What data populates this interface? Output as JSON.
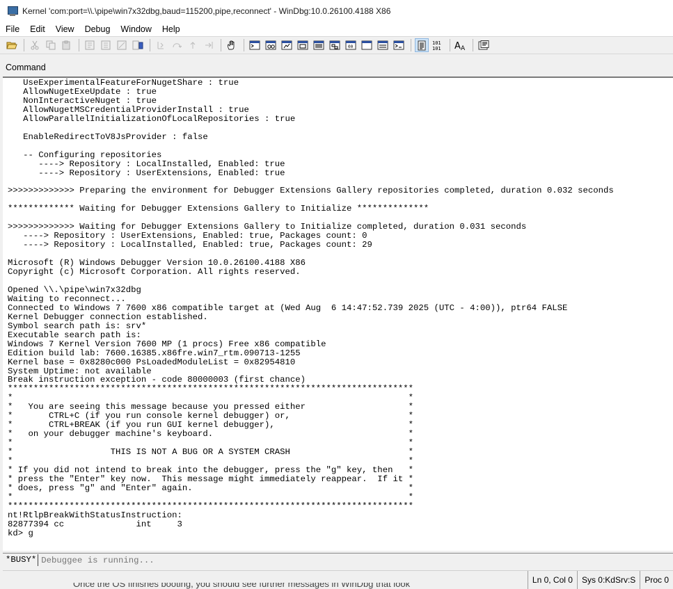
{
  "window": {
    "title": "Kernel 'com:port=\\\\.\\pipe\\win7x32dbg,baud=115200,pipe,reconnect' - WinDbg:10.0.26100.4188 X86"
  },
  "menu": {
    "items": [
      "File",
      "Edit",
      "View",
      "Debug",
      "Window",
      "Help"
    ]
  },
  "toolbar": {
    "buttons": [
      "open-icon",
      "cut-icon",
      "copy-icon",
      "paste-icon",
      "go-icon",
      "restart-icon",
      "stop-icon",
      "break-icon",
      "step-into-icon",
      "step-over-icon",
      "step-out-icon",
      "run-to-cursor-icon",
      "hand-icon",
      "command-icon",
      "watch-icon",
      "locals-icon",
      "registers-icon",
      "memory-icon",
      "call-stack-icon",
      "disassembly-icon",
      "scratch-pad-icon",
      "processes-icon",
      "source-mode-icon",
      "hex-icon",
      "font-icon",
      "options-icon"
    ]
  },
  "command_pane": {
    "title": "Command",
    "output_lines": [
      "   UseExperimentalFeatureForNugetShare : true",
      "   AllowNugetExeUpdate : true",
      "   NonInteractiveNuget : true",
      "   AllowNugetMSCredentialProviderInstall : true",
      "   AllowParallelInitializationOfLocalRepositories : true",
      "",
      "   EnableRedirectToV8JsProvider : false",
      "",
      "   -- Configuring repositories",
      "      ----> Repository : LocalInstalled, Enabled: true",
      "      ----> Repository : UserExtensions, Enabled: true",
      "",
      ">>>>>>>>>>>>> Preparing the environment for Debugger Extensions Gallery repositories completed, duration 0.032 seconds",
      "",
      "************* Waiting for Debugger Extensions Gallery to Initialize **************",
      "",
      ">>>>>>>>>>>>> Waiting for Debugger Extensions Gallery to Initialize completed, duration 0.031 seconds",
      "   ----> Repository : UserExtensions, Enabled: true, Packages count: 0",
      "   ----> Repository : LocalInstalled, Enabled: true, Packages count: 29",
      "",
      "Microsoft (R) Windows Debugger Version 10.0.26100.4188 X86",
      "Copyright (c) Microsoft Corporation. All rights reserved.",
      "",
      "Opened \\\\.\\pipe\\win7x32dbg",
      "Waiting to reconnect...",
      "Connected to Windows 7 7600 x86 compatible target at (Wed Aug  6 14:47:52.739 2025 (UTC - 4:00)), ptr64 FALSE",
      "Kernel Debugger connection established.",
      "Symbol search path is: srv*",
      "Executable search path is:",
      "Windows 7 Kernel Version 7600 MP (1 procs) Free x86 compatible",
      "Edition build lab: 7600.16385.x86fre.win7_rtm.090713-1255",
      "Kernel base = 0x8280c000 PsLoadedModuleList = 0x82954810",
      "System Uptime: not available",
      "Break instruction exception - code 80000003 (first chance)",
      "*******************************************************************************",
      "*                                                                             *",
      "*   You are seeing this message because you pressed either                    *",
      "*       CTRL+C (if you run console kernel debugger) or,                       *",
      "*       CTRL+BREAK (if you run GUI kernel debugger),                          *",
      "*   on your debugger machine's keyboard.                                      *",
      "*                                                                             *",
      "*                   THIS IS NOT A BUG OR A SYSTEM CRASH                       *",
      "*                                                                             *",
      "* If you did not intend to break into the debugger, press the \"g\" key, then   *",
      "* press the \"Enter\" key now.  This message might immediately reappear.  If it *",
      "* does, press \"g\" and \"Enter\" again.                                          *",
      "*                                                                             *",
      "*******************************************************************************",
      "nt!RtlpBreakWithStatusInstruction:",
      "82877394 cc              int     3",
      "kd> g"
    ],
    "busy_label": "*BUSY*",
    "input_placeholder": "Debuggee is running..."
  },
  "statusbar": {
    "line_col": "Ln 0, Col 0",
    "sys": "Sys 0:KdSrv:S",
    "proc": "Proc 0"
  },
  "background_text": "Once the OS finishes booting, you should see further messages in WinDbg that look"
}
